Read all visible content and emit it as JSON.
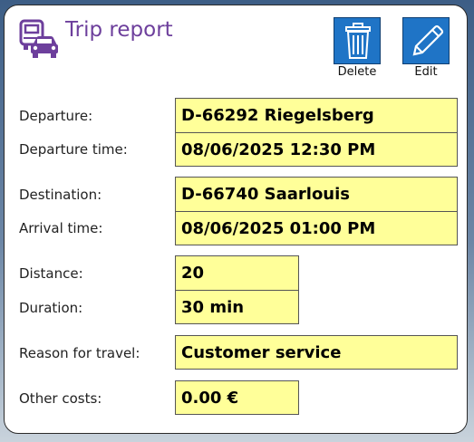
{
  "header": {
    "title": "Trip report"
  },
  "toolbar": {
    "delete_label": "Delete",
    "edit_label": "Edit"
  },
  "fields": {
    "departure": {
      "label": "Departure:",
      "value": "D-66292 Riegelsberg"
    },
    "departure_time": {
      "label": "Departure time:",
      "value": "08/06/2025 12:30 PM"
    },
    "destination": {
      "label": "Destination:",
      "value": "D-66740 Saarlouis"
    },
    "arrival_time": {
      "label": "Arrival time:",
      "value": "08/06/2025 01:00 PM"
    },
    "distance": {
      "label": "Distance:",
      "value": "20"
    },
    "duration": {
      "label": "Duration:",
      "value": "30 min"
    },
    "reason": {
      "label": "Reason for travel:",
      "value": "Customer service"
    },
    "other_costs": {
      "label": "Other costs:",
      "value": "0.00 €"
    }
  },
  "colors": {
    "accent": "#6d3f9c",
    "button": "#1f74c6",
    "field_bg": "#ffff99"
  },
  "icons": {
    "title": "vehicles-icon",
    "delete": "trash-icon",
    "edit": "pencil-icon"
  }
}
